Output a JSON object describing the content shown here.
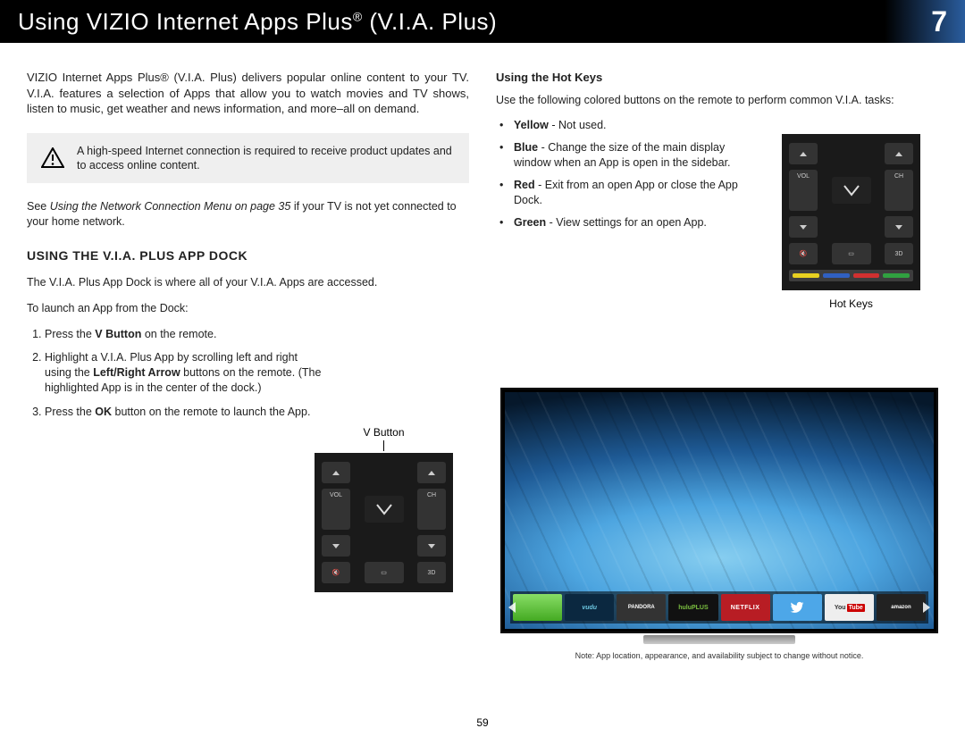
{
  "header": {
    "title_pre": "Using VIZIO Internet Apps Plus",
    "title_sup": "®",
    "title_post": " (V.I.A. Plus)",
    "chapter": "7"
  },
  "left": {
    "intro": "VIZIO Internet Apps Plus® (V.I.A. Plus) delivers popular online content to your TV. V.I.A. features a selection of Apps that allow you to watch movies and TV shows, listen to music, get weather and news information, and more–all on demand.",
    "warning": "A high-speed Internet connection is required to receive product updates and to access online content.",
    "see_pre": "See ",
    "see_italic": "Using the Network Connection Menu on page 35",
    "see_post": " if your TV is not yet connected to your home network.",
    "section": "USING THE V.I.A. PLUS APP DOCK",
    "p1": "The V.I.A. Plus App Dock is where all of your V.I.A. Apps are accessed.",
    "p2": "To launch an App from the Dock:",
    "steps": {
      "s1_pre": "Press the ",
      "s1_b": "V Button",
      "s1_post": " on the remote.",
      "s2_pre": "Highlight a V.I.A. Plus App by scrolling left and right using the ",
      "s2_b": "Left/Right Arrow",
      "s2_post": " buttons on the remote. (The highlighted App is in the center of the dock.)",
      "s3_pre": "Press the ",
      "s3_b": "OK",
      "s3_post": " button on the remote to launch the App."
    },
    "fig_label": "V Button"
  },
  "right": {
    "subh": "Using the Hot Keys",
    "intro": "Use the following colored buttons on the remote to perform common V.I.A. tasks:",
    "keys": {
      "y_b": "Yellow",
      "y_t": " - Not used.",
      "b_b": "Blue",
      "b_t": " - Change the size of the main display window when an App is open in the sidebar.",
      "r_b": "Red",
      "r_t": " - Exit from an open App or close the App Dock.",
      "g_b": "Green",
      "g_t": " - View settings for an open App."
    },
    "fig_label": "Hot Keys",
    "tv_note": "Note: App location, appearance, and availability subject to change without notice.",
    "apps": {
      "vudu": "vudu",
      "pandora": "PANDORA",
      "hulu": "huluPLUS",
      "netflix": "NETFLIX",
      "yt1": "You",
      "yt2": "Tube",
      "amazon": "amazon"
    }
  },
  "remote": {
    "vol": "VOL",
    "ch": "CH",
    "td": "3D"
  },
  "page": "59"
}
